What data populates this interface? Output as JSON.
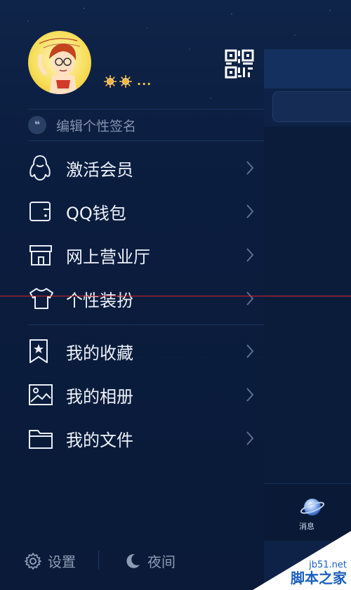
{
  "profile": {
    "avatar_icon": "cartoon-avatar",
    "level_badges": [
      "sun-badge",
      "sun-badge"
    ],
    "level_more": "...",
    "qr_icon": "qr-code-icon"
  },
  "signature": {
    "icon": "quote-icon",
    "quote_glyph": "❝",
    "placeholder": "编辑个性签名"
  },
  "menu": {
    "group1": [
      {
        "label": "激活会员",
        "icon": "penguin-icon"
      },
      {
        "label": "QQ钱包",
        "icon": "wallet-icon"
      },
      {
        "label": "网上营业厅",
        "icon": "store-icon"
      },
      {
        "label": "个性装扮",
        "icon": "tshirt-icon"
      }
    ],
    "group2": [
      {
        "label": "我的收藏",
        "icon": "bookmark-star-icon"
      },
      {
        "label": "我的相册",
        "icon": "photo-icon"
      },
      {
        "label": "我的文件",
        "icon": "folder-icon"
      }
    ]
  },
  "footer": {
    "settings_label": "设置",
    "night_label": "夜间"
  },
  "right_pane": {
    "tab_label": "消息"
  },
  "watermark": {
    "site": "jb51.net",
    "name": "脚本之家"
  },
  "colors": {
    "background": "#0b1c3d",
    "text_primary": "#eef2f9",
    "text_muted": "#8392ad",
    "divider": "#1d3761",
    "overlay_line": "#d4262c"
  }
}
